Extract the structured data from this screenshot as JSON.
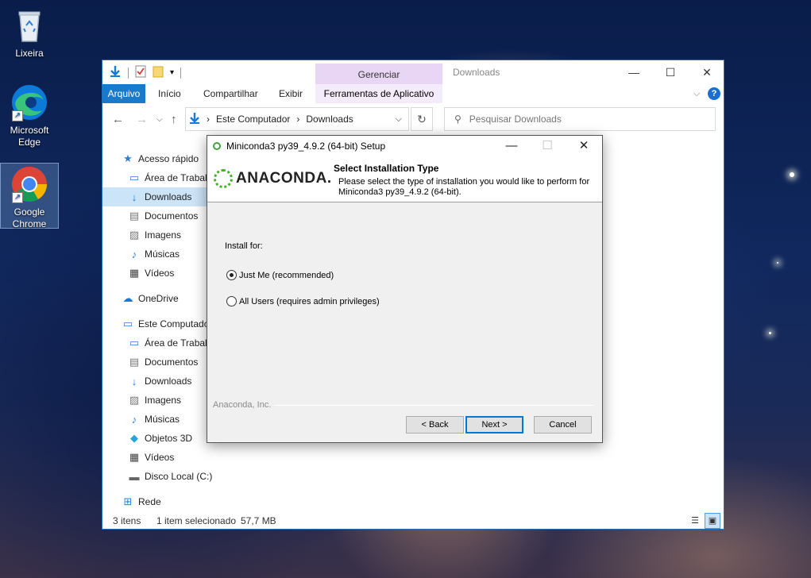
{
  "desktop": {
    "icons": [
      {
        "label": "Lixeira",
        "icon": "recycle-bin-icon"
      },
      {
        "label": "Microsoft Edge",
        "icon": "edge-icon"
      },
      {
        "label": "Google Chrome",
        "icon": "chrome-icon"
      }
    ]
  },
  "explorer": {
    "title": "Downloads",
    "manage_tab": "Gerenciar",
    "ribbon_tabs": [
      "Arquivo",
      "Início",
      "Compartilhar",
      "Exibir",
      "Ferramentas de Aplicativo"
    ],
    "address": {
      "parts": [
        "Este Computador",
        "Downloads"
      ]
    },
    "search_placeholder": "Pesquisar Downloads",
    "nav": [
      {
        "label": "Acesso rápido",
        "icon": "star-icon"
      },
      {
        "label": "Área de Trabalho",
        "icon": "desktop-icon"
      },
      {
        "label": "Downloads",
        "icon": "download-icon",
        "selected": true
      },
      {
        "label": "Documentos",
        "icon": "document-icon"
      },
      {
        "label": "Imagens",
        "icon": "image-icon"
      },
      {
        "label": "Músicas",
        "icon": "music-icon"
      },
      {
        "label": "Vídeos",
        "icon": "video-icon"
      },
      {
        "label": "OneDrive",
        "icon": "cloud-icon"
      },
      {
        "label": "Este Computador",
        "icon": "computer-icon"
      },
      {
        "label": "Área de Trabalho",
        "icon": "desktop-icon"
      },
      {
        "label": "Documentos",
        "icon": "document-icon"
      },
      {
        "label": "Downloads",
        "icon": "download-icon"
      },
      {
        "label": "Imagens",
        "icon": "image-icon"
      },
      {
        "label": "Músicas",
        "icon": "music-icon"
      },
      {
        "label": "Objetos 3D",
        "icon": "cube-icon"
      },
      {
        "label": "Vídeos",
        "icon": "video-icon"
      },
      {
        "label": "Disco Local (C:)",
        "icon": "drive-icon"
      },
      {
        "label": "Rede",
        "icon": "network-icon"
      }
    ],
    "status": {
      "items": "3 itens",
      "selected": "1 item selecionado",
      "size": "57,7 MB"
    }
  },
  "setup": {
    "title": "Miniconda3 py39_4.9.2 (64-bit) Setup",
    "logo_text": "ANACONDA.",
    "header_title": "Select Installation Type",
    "header_subtitle": "Please select the type of installation you would like to perform for Miniconda3 py39_4.9.2 (64-bit).",
    "install_for_label": "Install for:",
    "options": [
      {
        "label": "Just Me (recommended)",
        "checked": true
      },
      {
        "label": "All Users (requires admin privileges)",
        "checked": false
      }
    ],
    "brand": "Anaconda, Inc.",
    "buttons": {
      "back": "< Back",
      "next": "Next >",
      "cancel": "Cancel"
    }
  },
  "colors": {
    "accent": "#1979ca",
    "manage_tab": "#e9d6f5",
    "selection": "#cce4f7",
    "anaconda_green": "#43b02a"
  }
}
